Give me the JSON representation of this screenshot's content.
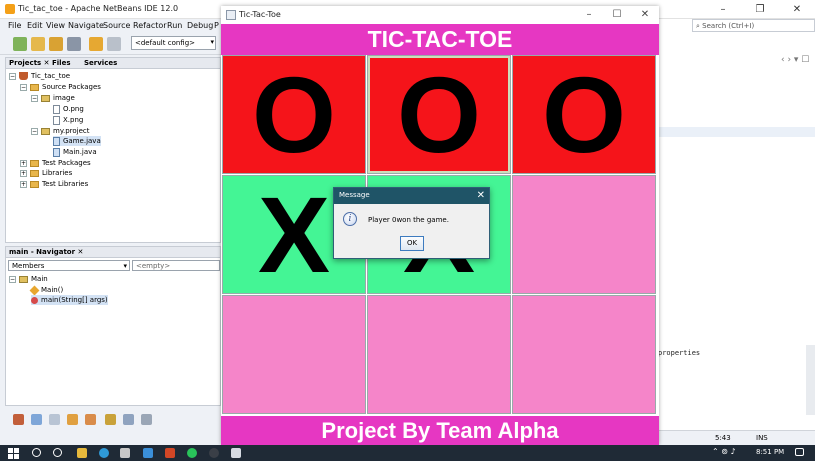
{
  "ide": {
    "title": "Tic_tac_toe - Apache NetBeans IDE 12.0",
    "menu": [
      "File",
      "Edit",
      "View",
      "Navigate",
      "Source",
      "Refactor",
      "Run",
      "Debug",
      "P"
    ],
    "config": "<default config>",
    "search_placeholder": "Search (Ctrl+I)",
    "projects_tabs": [
      "Projects",
      "Files",
      "Services"
    ],
    "project_tree": [
      {
        "label": "Tic_tac_toe",
        "icon": "project-icon"
      },
      {
        "label": "Source Packages",
        "icon": "folder-icon"
      },
      {
        "label": "image",
        "icon": "package-icon"
      },
      {
        "label": "O.png",
        "icon": "file-icon"
      },
      {
        "label": "X.png",
        "icon": "file-icon"
      },
      {
        "label": "my.project",
        "icon": "package-icon"
      },
      {
        "label": "Game.java",
        "icon": "java-file-icon"
      },
      {
        "label": "Main.java",
        "icon": "java-file-icon"
      },
      {
        "label": "Test Packages",
        "icon": "folder-icon"
      },
      {
        "label": "Libraries",
        "icon": "folder-icon"
      },
      {
        "label": "Test Libraries",
        "icon": "folder-icon"
      }
    ],
    "navigator_title": "main - Navigator",
    "navigator_filter": "Members",
    "navigator_empty": "<empty>",
    "navigator_tree": [
      "Main",
      "Main()",
      "main(String[] args)"
    ],
    "output_text": "properties",
    "status_position": "5:43",
    "status_mode": "INS"
  },
  "game": {
    "window_title": "Tic-Tac-Toe",
    "header": "TIC-TAC-TOE",
    "footer": "Project By Team Alpha",
    "board": [
      {
        "mark": "O",
        "color": "#f5141a"
      },
      {
        "mark": "O",
        "color": "#f5141a"
      },
      {
        "mark": "O",
        "color": "#f5141a"
      },
      {
        "mark": "X",
        "color": "#44f595"
      },
      {
        "mark": "X",
        "color": "#44f595"
      },
      {
        "mark": "",
        "color": "#f585c9"
      },
      {
        "mark": "",
        "color": "#f585c9"
      },
      {
        "mark": "",
        "color": "#f585c9"
      },
      {
        "mark": "",
        "color": "#f585c9"
      }
    ]
  },
  "dialog": {
    "title": "Message",
    "message": "Player 0won the game.",
    "ok_label": "OK"
  },
  "taskbar": {
    "time": "8:51 PM"
  },
  "colors": {
    "header_magenta": "#e637c2",
    "dialog_titlebar": "#1f5467"
  }
}
